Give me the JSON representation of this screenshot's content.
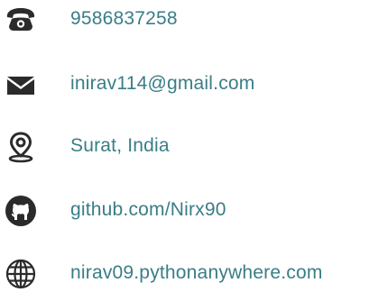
{
  "contacts": [
    {
      "icon": "phone-icon",
      "text": "9586837258"
    },
    {
      "icon": "mail-icon",
      "text": "inirav114@gmail.com"
    },
    {
      "icon": "location-pin-icon",
      "text": "Surat, India"
    },
    {
      "icon": "github-icon",
      "text": "github.com/Nirx90"
    },
    {
      "icon": "globe-icon",
      "text": "nirav09.pythonanywhere.com"
    }
  ],
  "colors": {
    "text": "#3a7d86",
    "icon": "#2b2b2b"
  }
}
